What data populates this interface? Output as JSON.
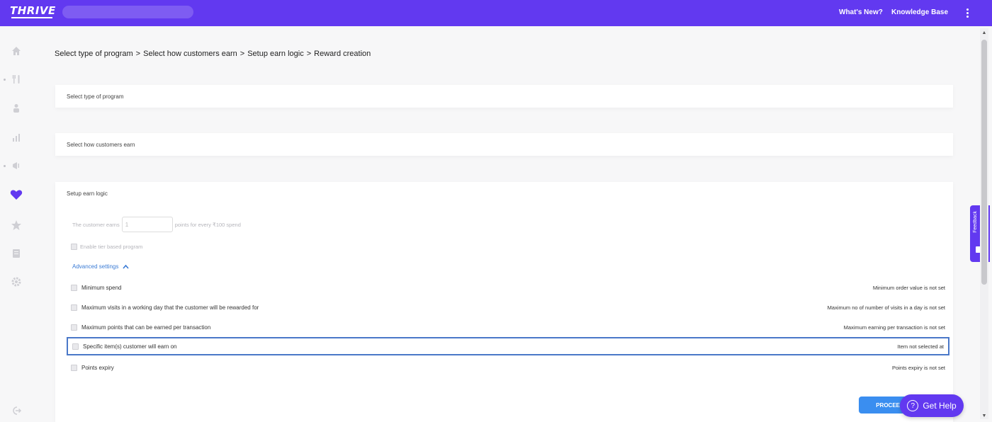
{
  "header": {
    "logo": "THRIVE",
    "whats_new": "What's New?",
    "knowledge_base": "Knowledge Base"
  },
  "breadcrumb": [
    "Select type of program",
    "Select how customers earn",
    "Setup earn logic",
    "Reward creation"
  ],
  "breadcrumb_separator": ">",
  "cards": {
    "program_type": "Select type of program",
    "how_customers_earn": "Select how customers earn",
    "earn_logic": "Setup earn logic"
  },
  "earn_logic": {
    "prefix": "The customer earns",
    "points_value": "1",
    "suffix": "points for every ₹100 spend",
    "tier_label": "Enable tier based program",
    "advanced_settings": "Advanced settings"
  },
  "settings": [
    {
      "label": "Minimum spend",
      "status": "Minimum order value is not set"
    },
    {
      "label": "Maximum visits in a working day that the customer will be rewarded for",
      "status": "Maximum no of number of visits in a day is not set"
    },
    {
      "label": "Maximum points that can be earned per transaction",
      "status": "Maximum earning per transaction is not set"
    },
    {
      "label": "Specific item(s) customer will earn on",
      "status": "Item not selected at"
    },
    {
      "label": "Points expiry",
      "status": "Points expiry is not set"
    }
  ],
  "proceed_label": "PROCEED",
  "get_help_label": "Get Help",
  "feedback_label": "Feedback",
  "colors": {
    "brand": "#6239f0",
    "primary_button": "#3a8ef0",
    "link": "#3a7bd5",
    "selected_border": "#4a78c8"
  },
  "sidebar_icons": [
    "home-icon",
    "cutlery-icon",
    "person-icon",
    "bar-chart-icon",
    "megaphone-icon",
    "heart-icon",
    "star-icon",
    "document-icon",
    "settings-icon",
    "logout-icon"
  ]
}
